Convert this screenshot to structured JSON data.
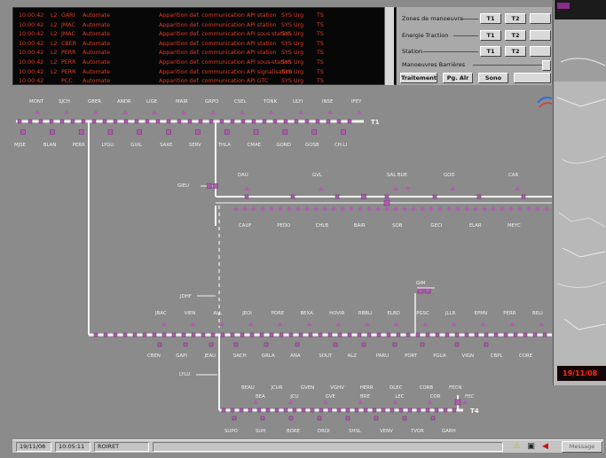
{
  "alarm_panel": {
    "rows": [
      {
        "time": "10:00:42",
        "line": "L2",
        "code": "GARI",
        "mode": "Automate",
        "message": "Apparition def. communication API station",
        "source": "SYS",
        "level": "Urg",
        "tag": "TS"
      },
      {
        "time": "10:00:42",
        "line": "L2",
        "code": "JMAC",
        "mode": "Automate",
        "message": "Apparition def. communication API station",
        "source": "SYS",
        "level": "Urg",
        "tag": "TS"
      },
      {
        "time": "10:00:42",
        "line": "L2",
        "code": "JMAC",
        "mode": "Automate",
        "message": "Apparition def. communication API sous station",
        "source": "SYS",
        "level": "Urg",
        "tag": "TS"
      },
      {
        "time": "10:00:42",
        "line": "L2",
        "code": "CBER",
        "mode": "Automate",
        "message": "Apparition def. communication API station",
        "source": "SYS",
        "level": "Urg",
        "tag": "TS"
      },
      {
        "time": "10:00:42",
        "line": "L2",
        "code": "PERR",
        "mode": "Automate",
        "message": "Apparition def. communication API station",
        "source": "SYS",
        "level": "Urg",
        "tag": "TS"
      },
      {
        "time": "10:00:42",
        "line": "L2",
        "code": "PERR",
        "mode": "Automate",
        "message": "Apparition def. communication API sous-station",
        "source": "SYS",
        "level": "Urg",
        "tag": "TS"
      },
      {
        "time": "10:00:42",
        "line": "L2",
        "code": "PERR",
        "mode": "Automate",
        "message": "Apparition def. communication API signalisation",
        "source": "SYS",
        "level": "Urg",
        "tag": "TS"
      },
      {
        "time": "10:00:42",
        "line": "",
        "code": "PCC",
        "mode": "Automate",
        "message": "Apparition def. communication API GTC",
        "source": "SYS",
        "level": "Urg",
        "tag": "TS"
      }
    ]
  },
  "control_panel": {
    "zones_label": "Zones de manoeuvre",
    "energie_label": "Energie Traction",
    "station_label": "Station",
    "manoeuvres_label": "Manoeuvres Barrières",
    "t1": "T1",
    "t2": "T2",
    "traitement": "Traitement",
    "pg_alr": "Pg. Alr",
    "sono": "Sono"
  },
  "network": {
    "tracks": {
      "t1": "T1",
      "t4": "T4"
    },
    "line1_top": [
      "MONT",
      "SJCH",
      "GBER",
      "ANDR",
      "LIGE",
      "MAIR",
      "GRPO",
      "CSEL",
      "TONK",
      "ULYI",
      "INSE",
      "IFEY"
    ],
    "line1_bottom": [
      "MJSE",
      "BLAN",
      "PERR",
      "LYGU",
      "GUIL",
      "SAXE",
      "SERV",
      "THLA",
      "CMAE",
      "GOND",
      "GOSB",
      "CH.LI"
    ],
    "branch_label": "GIEU",
    "line2_top": [
      "DAU",
      "GVL",
      "SAL BUE",
      "GOD",
      "CAR"
    ],
    "line2_bottom": [
      "CAUF",
      "PEDO",
      "CHLB",
      "BAIR",
      "SOB",
      "GECI",
      "ELAR",
      "MEYC"
    ],
    "gim_label": "GIM",
    "jdhf_label": "JDHF",
    "line3_top": [
      "JBAC",
      "VIEN",
      "ALL",
      "JEOI",
      "PDRE",
      "BEXA",
      "HOVIR",
      "RBBLI",
      "ELBO",
      "PGSC",
      "JLLR",
      "EPMV",
      "PERR",
      "BELI"
    ],
    "line3_bottom": [
      "CBEN",
      "GAPI",
      "JEAU",
      "SACH",
      "GRLA",
      "ANA",
      "SOUT",
      "ALZ",
      "PARU",
      "PORT",
      "PGLA",
      "VIGN",
      "CBPL",
      "CORE"
    ],
    "lyli_label": "LYLU",
    "line4_top": [
      "BEAU",
      "JCUR",
      "GVEN",
      "VGHV",
      "HERR",
      "DLEC",
      "CORB",
      "FECN"
    ],
    "line4_mid": [
      "BEA",
      "JCU",
      "GVE",
      "BRE",
      "LEC",
      "COR",
      "FEC"
    ],
    "line4_bottom": [
      "SUPO",
      "SUH",
      "BORE",
      "DROI",
      "SHSL",
      "VENV",
      "TVOR",
      "GARH"
    ]
  },
  "side_window": {
    "date": "19/11/08"
  },
  "status_bar": {
    "date": "19/11/08",
    "time": "10:05:11",
    "user": "ROIRET",
    "message_label": "Message"
  },
  "colors": {
    "background": "#8b8b8b",
    "track": "#f2f2f2",
    "station": "#b05cb0",
    "alarm_text": "#e13b22"
  }
}
